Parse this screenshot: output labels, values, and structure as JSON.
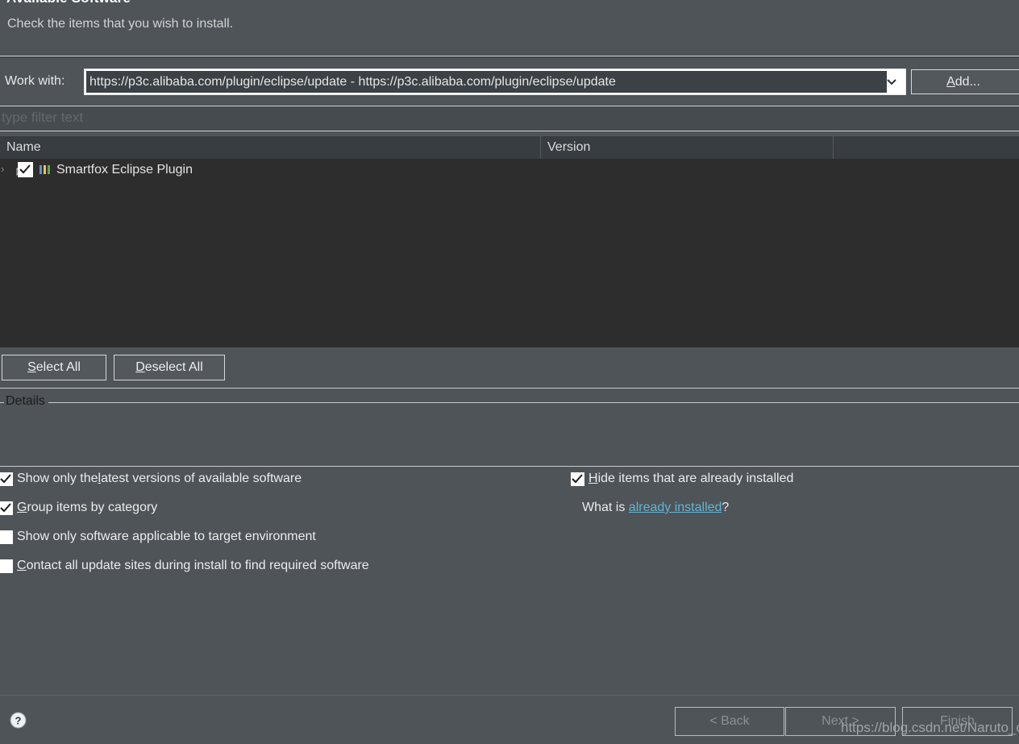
{
  "dialog": {
    "title": "Available Software",
    "subtitle": "Check the items that you wish to install."
  },
  "work_with": {
    "label": "Work with:",
    "value": "https://p3c.alibaba.com/plugin/eclipse/update - https://p3c.alibaba.com/plugin/eclipse/update",
    "add_button": "Add...",
    "add_button_mnemonic": "A",
    "add_button_rest": "dd...",
    "dropdown_icon": "chevron-down-icon"
  },
  "filter": {
    "placeholder": "type filter text",
    "value": ""
  },
  "table": {
    "columns": [
      "Name",
      "Version",
      ""
    ],
    "rows": [
      {
        "name": "Smartfox Eclipse Plugin",
        "version": "",
        "checked": true,
        "expanded": false,
        "icon": "category-bars-icon",
        "icon_colors": [
          "#6d8fc4",
          "#e8c55a",
          "#63a94f"
        ]
      }
    ]
  },
  "selection_buttons": {
    "select_all": "Select All",
    "select_all_mnemonic": "S",
    "select_all_rest": "elect All",
    "deselect_all": "Deselect All",
    "deselect_all_mnemonic": "D",
    "deselect_all_rest": "eselect All"
  },
  "details": {
    "group_label": "Details",
    "body": ""
  },
  "options": {
    "left": [
      {
        "pre": "Show only the ",
        "mnemonic": "l",
        "post": "atest versions of available software",
        "checked": true
      },
      {
        "pre": "",
        "mnemonic": "G",
        "post": "roup items by category",
        "checked": true
      },
      {
        "pre": "Show only software applicable to target environment",
        "mnemonic": "",
        "post": "",
        "checked": false
      },
      {
        "pre": "",
        "mnemonic": "C",
        "post": "ontact all update sites during install to find required software",
        "checked": false
      }
    ],
    "right": [
      {
        "pre": "",
        "mnemonic": "H",
        "post": "ide items that are already installed",
        "checked": true
      }
    ],
    "what_is_prefix": "What is ",
    "what_is_link": "already installed",
    "what_is_suffix": "?"
  },
  "footer": {
    "help_icon": "help-question-icon",
    "buttons": [
      {
        "label": "< Back",
        "enabled": false
      },
      {
        "label": "Next >",
        "enabled": false
      },
      {
        "label": "Finish",
        "enabled": false
      }
    ]
  },
  "watermark": {
    "text": "https://blog.csdn.net/Naruto_c"
  },
  "colors": {
    "dialog_bg": "#4e5458",
    "list_bg": "#2d2d2d",
    "header_bg": "#383d41",
    "link": "#62b5d6",
    "text": "#e8e8e8",
    "disabled_text": "#8a9095"
  }
}
